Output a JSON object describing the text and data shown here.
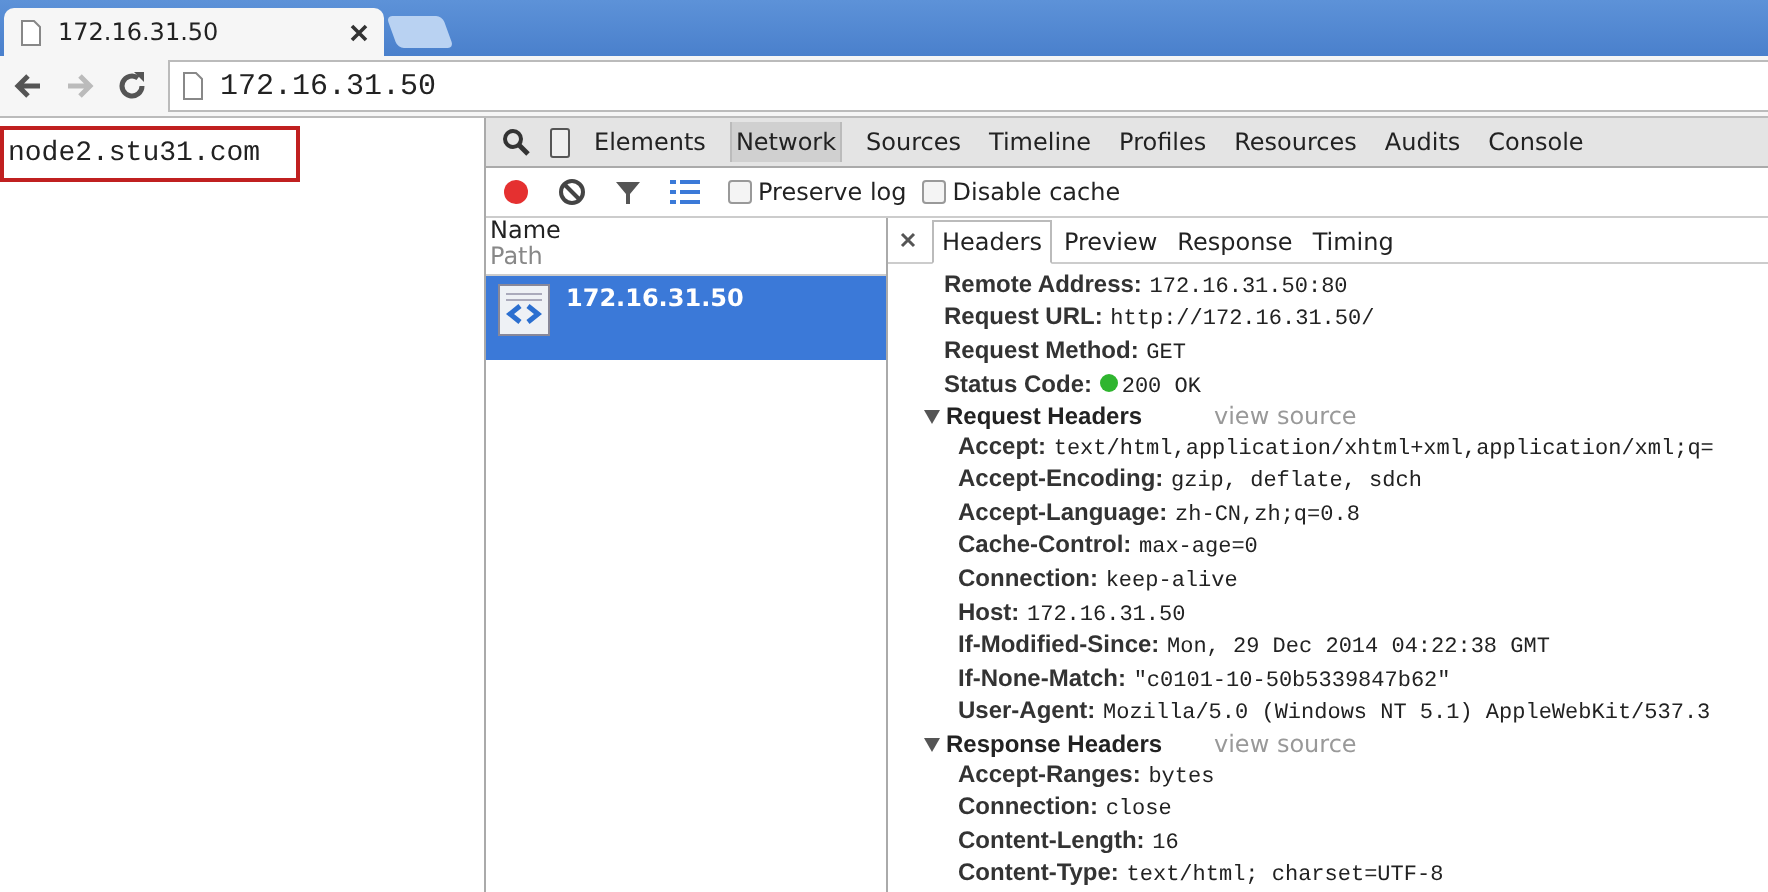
{
  "browser": {
    "tabs": [
      {
        "title": "172.16.31.50",
        "selected": true
      },
      {
        "selected": false
      }
    ],
    "address": "172.16.31.50"
  },
  "page": {
    "text": "node2.stu31.com"
  },
  "devtools": {
    "panels": [
      {
        "label": "Elements",
        "selected": false
      },
      {
        "label": "Network",
        "selected": true
      },
      {
        "label": "Sources",
        "selected": false
      },
      {
        "label": "Timeline",
        "selected": false
      },
      {
        "label": "Profiles",
        "selected": false
      },
      {
        "label": "Resources",
        "selected": false
      },
      {
        "label": "Audits",
        "selected": false
      },
      {
        "label": "Console",
        "selected": false
      }
    ],
    "recording": true,
    "options": [
      {
        "label": "Preserve log",
        "checked": false
      },
      {
        "label": "Disable cache",
        "checked": false
      }
    ],
    "list": {
      "column": "Name",
      "subcolumn": "Path",
      "rows": [
        {
          "name": "172.16.31.50",
          "selected": true
        }
      ]
    },
    "detail_tabs": [
      {
        "label": "Headers",
        "selected": true
      },
      {
        "label": "Preview",
        "selected": false
      },
      {
        "label": "Response",
        "selected": false
      },
      {
        "label": "Timing",
        "selected": false
      }
    ],
    "general": [
      {
        "key": "Remote Address:",
        "value": "172.16.31.50:80"
      },
      {
        "key": "Request URL:",
        "value": "http://172.16.31.50/"
      },
      {
        "key": "Request Method:",
        "value": "GET"
      },
      {
        "key": "Status Code:",
        "value": "200 OK",
        "color": "#2fb52f"
      }
    ],
    "sections": [
      {
        "title": "Request Headers",
        "expanded": true,
        "link": "view source",
        "headers": [
          {
            "key": "Accept:",
            "value": "text/html,application/xhtml+xml,application/xml;q="
          },
          {
            "key": "Accept-Encoding:",
            "value": "gzip, deflate, sdch"
          },
          {
            "key": "Accept-Language:",
            "value": "zh-CN,zh;q=0.8"
          },
          {
            "key": "Cache-Control:",
            "value": "max-age=0"
          },
          {
            "key": "Connection:",
            "value": "keep-alive"
          },
          {
            "key": "Host:",
            "value": "172.16.31.50"
          },
          {
            "key": "If-Modified-Since:",
            "value": "Mon, 29 Dec 2014 04:22:38 GMT"
          },
          {
            "key": "If-None-Match:",
            "value": "\"c0101-10-50b5339847b62\""
          },
          {
            "key": "User-Agent:",
            "value": "Mozilla/5.0 (Windows NT 5.1) AppleWebKit/537.3"
          }
        ]
      },
      {
        "title": "Response Headers",
        "expanded": true,
        "link": "view source",
        "headers": [
          {
            "key": "Accept-Ranges:",
            "value": "bytes"
          },
          {
            "key": "Connection:",
            "value": "close"
          },
          {
            "key": "Content-Length:",
            "value": "16"
          },
          {
            "key": "Content-Type:",
            "value": "text/html; charset=UTF-8"
          }
        ]
      }
    ]
  }
}
